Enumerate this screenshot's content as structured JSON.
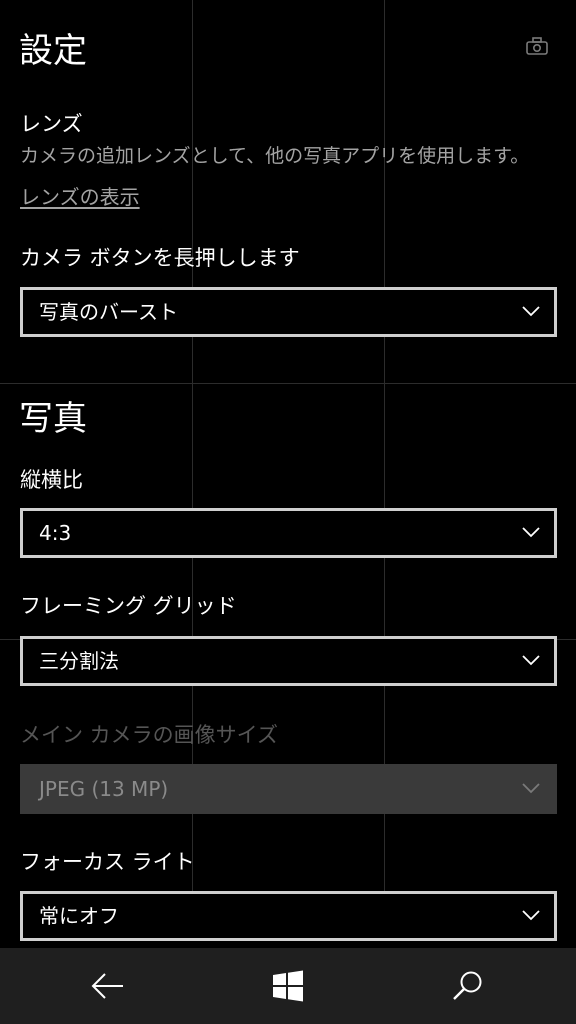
{
  "header": {
    "title": "設定"
  },
  "lens": {
    "title": "レンズ",
    "description": "カメラの追加レンズとして、他の写真アプリを使用します。",
    "link": "レンズの表示"
  },
  "camera_button": {
    "label": "カメラ ボタンを長押しします",
    "value": "写真のバースト"
  },
  "photo_section": {
    "title": "写真",
    "aspect_ratio": {
      "label": "縦横比",
      "value": "4:3"
    },
    "framing_grid": {
      "label": "フレーミング グリッド",
      "value": "三分割法"
    },
    "image_size": {
      "label": "メイン カメラの画像サイズ",
      "value": "JPEG (13 MP)",
      "disabled": true
    },
    "focus_light": {
      "label": "フォーカス ライト",
      "value": "常にオフ"
    }
  },
  "taskbar": {
    "buttons": [
      "back-arrow-icon",
      "windows-start-icon",
      "search-icon"
    ]
  },
  "colors": {
    "background": "#000000",
    "text": "#ffffff",
    "secondary_text": "#a3a3a3",
    "dropdown_border": "#cfcfcf",
    "disabled_fill": "#3a3a3a",
    "taskbar": "#1f1f1f"
  }
}
